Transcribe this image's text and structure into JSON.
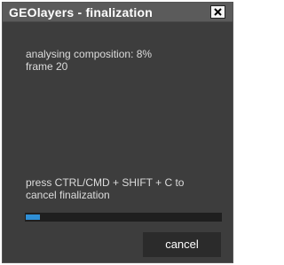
{
  "window": {
    "title": "GEOlayers - finalization"
  },
  "icons": {
    "close": "close-icon"
  },
  "status": {
    "analysing": "analysing composition: 8%",
    "frame": "frame 20"
  },
  "hint": {
    "line1": "press CTRL/CMD + SHIFT + C to",
    "line2": "cancel finalization"
  },
  "progress": {
    "value": 0.08
  },
  "buttons": {
    "cancel": "cancel"
  },
  "colors": {
    "background": "#3d3d3d",
    "titlebar": "#5b5b5b",
    "progress_fill": "#2f8fd6",
    "progress_track": "#1f1f1f",
    "button": "#2b2b2b"
  }
}
